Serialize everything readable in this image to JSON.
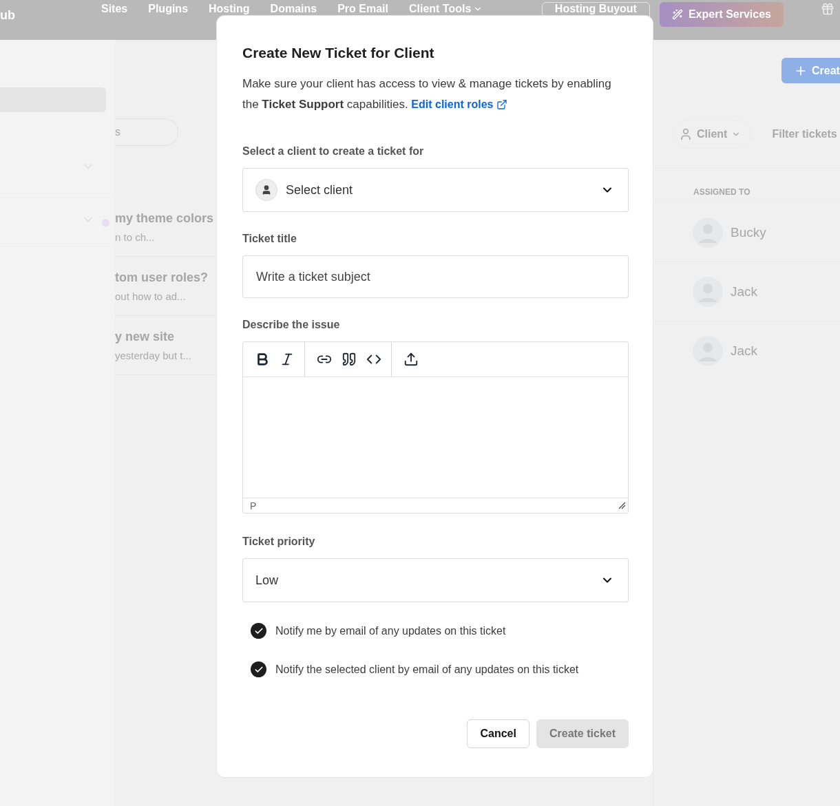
{
  "top_nav": {
    "brand": "ub",
    "items": [
      {
        "label": "Sites"
      },
      {
        "label": "Plugins"
      },
      {
        "label": "Hosting"
      },
      {
        "label": "Domains"
      },
      {
        "label": "Pro Email"
      },
      {
        "label": "Client Tools",
        "dropdown": true
      }
    ],
    "buyout_button": "Hosting Buyout",
    "expert_button": "Expert Services"
  },
  "ticket_list": {
    "filter_pill": "s",
    "rows": [
      {
        "title": "my theme colors",
        "preview": "n to ch...",
        "unread": true
      },
      {
        "title": "tom user roles?",
        "preview": " out how to ad...",
        "unread": false
      },
      {
        "title": "y new site",
        "preview": "yesterday but t...",
        "unread": false
      }
    ]
  },
  "right_panel": {
    "create_button": "Creat",
    "client_filter": "Client",
    "filter_search": "Filter tickets",
    "assigned_header": "ASSIGNED TO",
    "assignees": [
      "Bucky",
      "Jack",
      "Jack"
    ]
  },
  "modal": {
    "title": "Create New Ticket for Client",
    "description": "Make sure your client has access to view & manage tickets by enabling the **Ticket Support** capabilities.",
    "roles_link": "Edit client roles",
    "client_label": "Select a client to create a ticket for",
    "client_select": "Select client",
    "title_label": "Ticket title",
    "title_field": {
      "placeholder": "Write a ticket subject"
    },
    "issue_label": "Describe the issue",
    "editor_status": "P",
    "priority_label": "Ticket priority",
    "priority_select": "Low",
    "checkboxes": [
      {
        "label": "Notify me by email of any updates on this ticket",
        "checked": true
      },
      {
        "label": "Notify the selected client by email of any updates on this ticket",
        "checked": true
      }
    ],
    "buttons": [
      {
        "label": "Cancel",
        "disabled": false
      },
      {
        "label": "Create ticket",
        "disabled": true
      }
    ]
  }
}
